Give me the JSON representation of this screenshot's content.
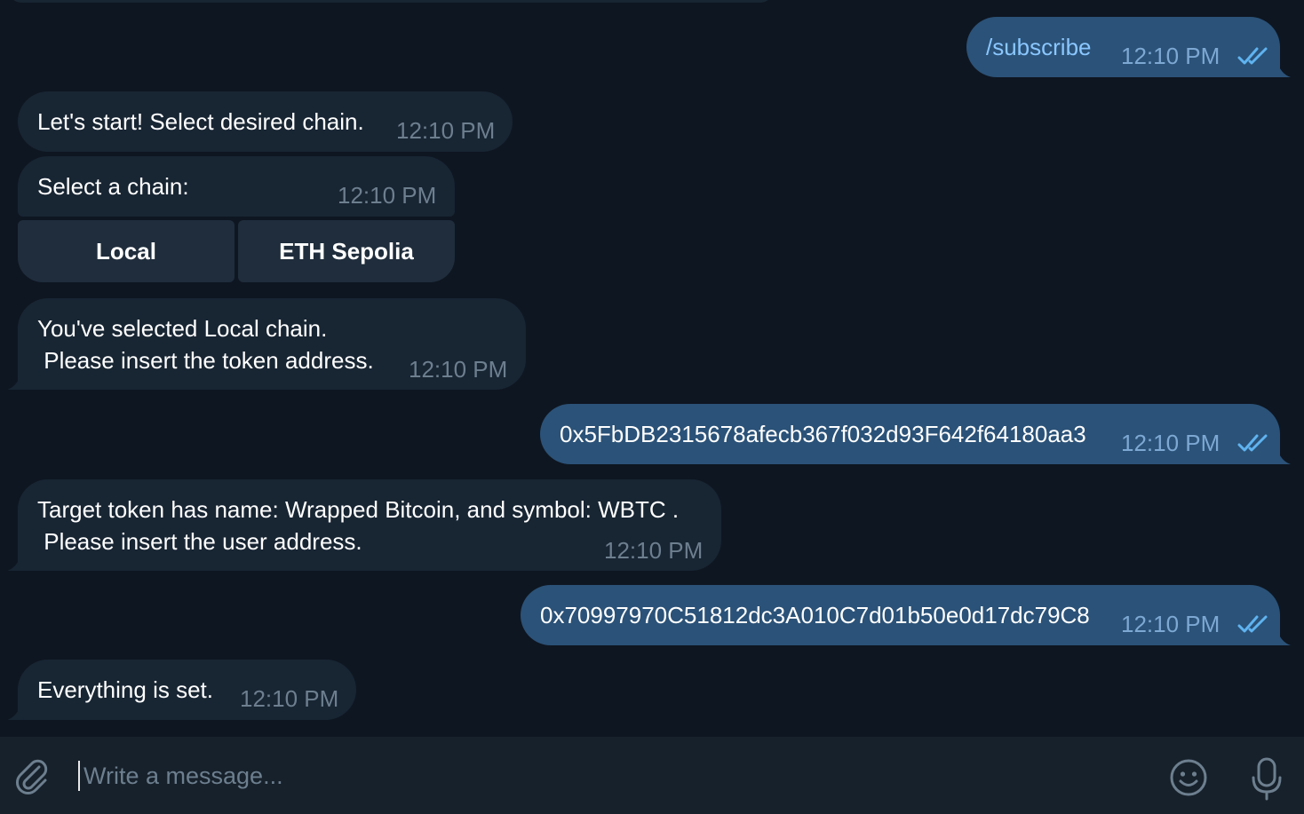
{
  "messages": [
    {
      "id": "m1",
      "direction": "out",
      "text": "/subscribe",
      "is_command": true,
      "time": "12:10 PM",
      "status": "read"
    },
    {
      "id": "m2",
      "direction": "in",
      "text": "Let's start! Select desired chain.",
      "time": "12:10 PM"
    },
    {
      "id": "m3",
      "direction": "in",
      "text": "Select a chain:",
      "time": "12:10 PM"
    },
    {
      "id": "m4",
      "direction": "in",
      "text": "You've selected Local chain.\n Please insert the token address.",
      "time": "12:10 PM"
    },
    {
      "id": "m5",
      "direction": "out",
      "text": "0x5FbDB2315678afecb367f032d93F642f64180aa3",
      "time": "12:10 PM",
      "status": "read"
    },
    {
      "id": "m6",
      "direction": "in",
      "text": "Target token has name: Wrapped Bitcoin, and symbol: WBTC .\n Please insert the user address.",
      "time": "12:10 PM"
    },
    {
      "id": "m7",
      "direction": "out",
      "text": "0x70997970C51812dc3A010C7d01b50e0d17dc79C8",
      "time": "12:10 PM",
      "status": "read"
    },
    {
      "id": "m8",
      "direction": "in",
      "text": "Everything is set.",
      "time": "12:10 PM"
    }
  ],
  "inline_keyboard": {
    "buttons": [
      {
        "label": "Local"
      },
      {
        "label": "ETH Sepolia"
      }
    ]
  },
  "composer": {
    "placeholder": "Write a message...",
    "attach_icon": "paperclip-icon",
    "emoji_icon": "smiley-icon",
    "voice_icon": "microphone-icon"
  },
  "colors": {
    "background": "#0e1621",
    "incoming_bubble": "#182533",
    "outgoing_bubble": "#2b5278",
    "keyboard_button": "#1f2d3c",
    "composer_bar": "#17212b",
    "command_link": "#8ac7ff",
    "read_checks": "#5fb3f0"
  }
}
